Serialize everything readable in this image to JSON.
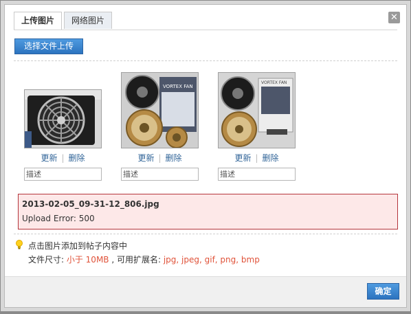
{
  "tabs": [
    {
      "label": "上传图片",
      "active": true
    },
    {
      "label": "网络图片",
      "active": false
    }
  ],
  "close_icon": "close-icon",
  "upload_button": "选择文件上传",
  "thumbnails": [
    {
      "update": "更新",
      "delete": "删除",
      "placeholder": "描述",
      "icon": "fan-photo"
    },
    {
      "update": "更新",
      "delete": "删除",
      "placeholder": "描述",
      "icon": "fan-photo"
    },
    {
      "update": "更新",
      "delete": "删除",
      "placeholder": "描述",
      "icon": "fan-photo"
    }
  ],
  "error": {
    "filename": "2013-02-05_09-31-12_806.jpg",
    "message": "Upload Error: 500"
  },
  "hint": {
    "icon": "lightbulb-icon",
    "line1": "点击图片添加到帖子内容中",
    "size_prefix": "文件尺寸: ",
    "size_value": "小于 10MB",
    "ext_prefix": " , 可用扩展名: ",
    "ext_value": "jpg, jpeg, gif, png, bmp"
  },
  "ok_button": "确定",
  "colors": {
    "accent": "#2c73bf",
    "error_border": "#b4333a",
    "error_bg": "#fde8e8",
    "highlight": "#e0533a"
  }
}
